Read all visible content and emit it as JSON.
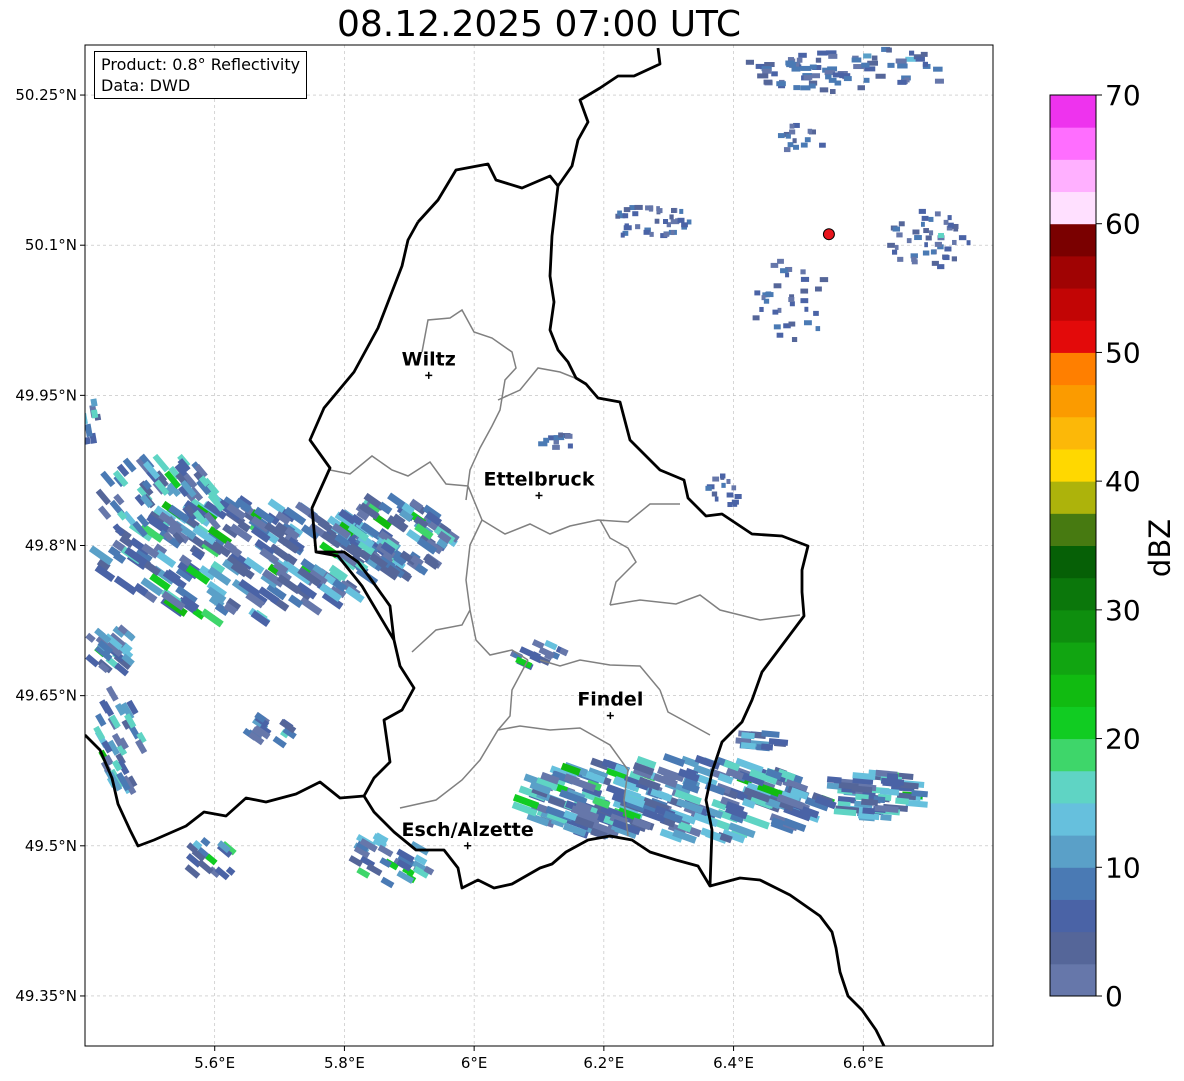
{
  "title": "08.12.2025 07:00 UTC",
  "info": {
    "product": "Product: 0.8° Reflectivity",
    "data": "Data: DWD"
  },
  "map": {
    "lon_range": [
      5.4,
      6.8
    ],
    "lat_range": [
      49.3,
      50.3
    ],
    "lon_ticks": [
      "5.6°E",
      "5.8°E",
      "6°E",
      "6.2°E",
      "6.4°E",
      "6.6°E"
    ],
    "lat_ticks": [
      "49.35°N",
      "49.5°N",
      "49.65°N",
      "49.8°N",
      "49.95°N",
      "50.1°N",
      "50.25°N"
    ],
    "gridlines": true,
    "cities": [
      {
        "name": "Wiltz",
        "lon": 5.93,
        "lat": 49.97
      },
      {
        "name": "Ettelbruck",
        "lon": 6.1,
        "lat": 49.85
      },
      {
        "name": "Findel",
        "lon": 6.21,
        "lat": 49.63
      },
      {
        "name": "Esch/Alzette",
        "lon": 5.99,
        "lat": 49.5
      }
    ],
    "radar_site": {
      "lon": 6.547,
      "lat": 50.111,
      "color": "#e8141c"
    }
  },
  "colorbar": {
    "label": "dBZ",
    "ticks": [
      "0",
      "10",
      "20",
      "30",
      "40",
      "50",
      "60",
      "70"
    ],
    "range": [
      0,
      70
    ],
    "colors": [
      "#6677aa",
      "#556699",
      "#4a63a6",
      "#4a7ab4",
      "#5aa0c8",
      "#66c0dd",
      "#5fd4c4",
      "#3ed66a",
      "#11cc22",
      "#11bb11",
      "#11a511",
      "#0e8e0e",
      "#0b770b",
      "#066006",
      "#477a11",
      "#adb30b",
      "#ffd800",
      "#fcb808",
      "#fb9b00",
      "#ff7f00",
      "#e30a0a",
      "#c20505",
      "#a00303",
      "#7a0000",
      "#ffe0ff",
      "#ffb0ff",
      "#ff6eff",
      "#ee33ee"
    ]
  }
}
